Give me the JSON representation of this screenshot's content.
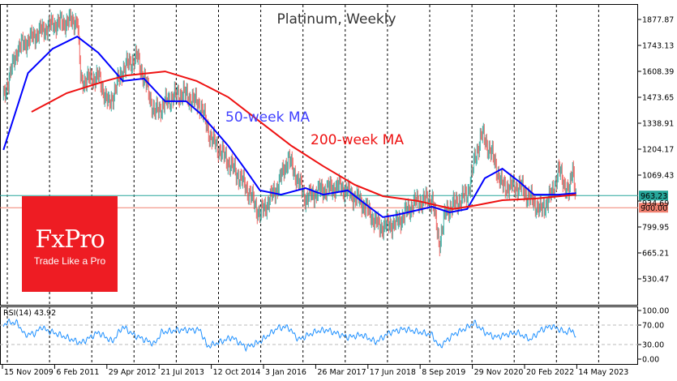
{
  "chart_data": [
    {
      "type": "candlestick",
      "title": "Platinum, Weekly",
      "yticks": [
        "1877.87",
        "1743.13",
        "1608.39",
        "1473.65",
        "1338.91",
        "1204.17",
        "1069.43",
        "934.69",
        "799.95",
        "665.21",
        "530.47"
      ],
      "xticks": [
        "15 Nov 2009",
        "6 Feb 2011",
        "29 Apr 2012",
        "21 Jul 2013",
        "12 Oct 2014",
        "3 Jan 2016",
        "26 Mar 2017",
        "17 Jun 2018",
        "8 Sep 2019",
        "29 Nov 2020",
        "20 Feb 2022",
        "14 May 2023"
      ],
      "ylim": [
        440,
        1920
      ],
      "price": [
        [
          "2009-11",
          1474
        ],
        [
          "2010-03",
          1726
        ],
        [
          "2010-09",
          1810
        ],
        [
          "2011-01",
          1852
        ],
        [
          "2011-08",
          1874
        ],
        [
          "2011-09",
          1558
        ],
        [
          "2012-02",
          1580
        ],
        [
          "2012-05",
          1430
        ],
        [
          "2012-09",
          1621
        ],
        [
          "2013-01",
          1684
        ],
        [
          "2013-04",
          1516
        ],
        [
          "2013-06",
          1390
        ],
        [
          "2013-11",
          1474
        ],
        [
          "2014-02",
          1495
        ],
        [
          "2014-07",
          1432
        ],
        [
          "2014-10",
          1263
        ],
        [
          "2015-03",
          1137
        ],
        [
          "2015-08",
          1010
        ],
        [
          "2015-12",
          863
        ],
        [
          "2016-05",
          1010
        ],
        [
          "2016-08",
          1158
        ],
        [
          "2017-01",
          948
        ],
        [
          "2017-05",
          990
        ],
        [
          "2017-11",
          1010
        ],
        [
          "2018-05",
          926
        ],
        [
          "2018-10",
          800
        ],
        [
          "2019-03",
          821
        ],
        [
          "2019-08",
          926
        ],
        [
          "2020-01",
          948
        ],
        [
          "2020-03",
          716
        ],
        [
          "2020-05",
          884
        ],
        [
          "2020-11",
          968
        ],
        [
          "2021-01",
          1137
        ],
        [
          "2021-03",
          1284
        ],
        [
          "2021-06",
          1179
        ],
        [
          "2021-09",
          1010
        ],
        [
          "2022-02",
          1010
        ],
        [
          "2022-08",
          884
        ],
        [
          "2022-11",
          968
        ],
        [
          "2023-01",
          1095
        ],
        [
          "2023-04",
          968
        ],
        [
          "2023-05",
          1116
        ],
        [
          "2023-06",
          963
        ]
      ],
      "series": [
        {
          "name": "50-week MA",
          "color": "#0000ff",
          "values": [
            [
              "2009-11",
              1200
            ],
            [
              "2010-06",
              1600
            ],
            [
              "2011-01",
              1726
            ],
            [
              "2011-08",
              1789
            ],
            [
              "2012-02",
              1705
            ],
            [
              "2012-09",
              1558
            ],
            [
              "2013-03",
              1571
            ],
            [
              "2013-09",
              1453
            ],
            [
              "2014-03",
              1453
            ],
            [
              "2014-07",
              1390
            ],
            [
              "2015-03",
              1221
            ],
            [
              "2015-08",
              1095
            ],
            [
              "2015-12",
              990
            ],
            [
              "2016-06",
              968
            ],
            [
              "2017-01",
              1002
            ],
            [
              "2017-06",
              968
            ],
            [
              "2018-01",
              990
            ],
            [
              "2018-07",
              905
            ],
            [
              "2018-11",
              851
            ],
            [
              "2019-03",
              863
            ],
            [
              "2020-01",
              905
            ],
            [
              "2020-06",
              876
            ],
            [
              "2020-11",
              893
            ],
            [
              "2021-04",
              1053
            ],
            [
              "2021-09",
              1103
            ],
            [
              "2022-02",
              1032
            ],
            [
              "2022-06",
              968
            ],
            [
              "2023-01",
              968
            ],
            [
              "2023-06",
              976
            ]
          ]
        },
        {
          "name": "200-week MA",
          "color": "#ee1111",
          "values": [
            [
              "2010-07",
              1398
            ],
            [
              "2011-05",
              1495
            ],
            [
              "2012-04",
              1558
            ],
            [
              "2012-10",
              1587
            ],
            [
              "2013-09",
              1608
            ],
            [
              "2014-06",
              1558
            ],
            [
              "2015-03",
              1474
            ],
            [
              "2015-12",
              1347
            ],
            [
              "2016-09",
              1221
            ],
            [
              "2017-06",
              1116
            ],
            [
              "2018-03",
              1019
            ],
            [
              "2018-11",
              960
            ],
            [
              "2019-09",
              935
            ],
            [
              "2020-07",
              893
            ],
            [
              "2021-02",
              914
            ],
            [
              "2021-09",
              939
            ],
            [
              "2022-06",
              947
            ],
            [
              "2023-06",
              968
            ]
          ]
        }
      ],
      "hlines": [
        {
          "label": "963.23",
          "value": 963.23,
          "color": "#26a69a"
        },
        {
          "label": "900.00",
          "value": 900,
          "color": "#f08070"
        }
      ],
      "grid": true
    },
    {
      "type": "line",
      "label": "RSI(14) 43.92",
      "ylim": [
        0,
        100
      ],
      "yticks": [
        "100.00",
        "70.00",
        "30.00",
        "0.00"
      ],
      "levels": [
        70,
        30
      ],
      "color": "#1e90ff",
      "values": [
        [
          "2009-11",
          69
        ],
        [
          "2009-12",
          76
        ],
        [
          "2010-03",
          74
        ],
        [
          "2010-05",
          50
        ],
        [
          "2010-08",
          53
        ],
        [
          "2010-10",
          67
        ],
        [
          "2010-11",
          60
        ],
        [
          "2011-03",
          50
        ],
        [
          "2011-09",
          33
        ],
        [
          "2012-02",
          55
        ],
        [
          "2012-06",
          36
        ],
        [
          "2012-09",
          67
        ],
        [
          "2012-12",
          50
        ],
        [
          "2013-06",
          31
        ],
        [
          "2013-08",
          55
        ],
        [
          "2014-01",
          60
        ],
        [
          "2014-07",
          60
        ],
        [
          "2014-09",
          26
        ],
        [
          "2015-01",
          36
        ],
        [
          "2015-04",
          45
        ],
        [
          "2015-08",
          24
        ],
        [
          "2015-12",
          36
        ],
        [
          "2016-05",
          64
        ],
        [
          "2016-08",
          66
        ],
        [
          "2016-11",
          40
        ],
        [
          "2017-04",
          57
        ],
        [
          "2017-07",
          60
        ],
        [
          "2018-01",
          45
        ],
        [
          "2018-05",
          50
        ],
        [
          "2018-09",
          35
        ],
        [
          "2019-01",
          55
        ],
        [
          "2019-05",
          62
        ],
        [
          "2020-01",
          50
        ],
        [
          "2020-03",
          25
        ],
        [
          "2020-07",
          50
        ],
        [
          "2020-11",
          65
        ],
        [
          "2021-01",
          75
        ],
        [
          "2021-04",
          55
        ],
        [
          "2021-07",
          45
        ],
        [
          "2022-01",
          55
        ],
        [
          "2022-05",
          40
        ],
        [
          "2022-08",
          60
        ],
        [
          "2022-11",
          68
        ],
        [
          "2023-03",
          55
        ],
        [
          "2023-05",
          60
        ],
        [
          "2023-06",
          44
        ]
      ]
    }
  ],
  "logo": {
    "brand": "FxPro",
    "tagline": "Trade Like a Pro"
  }
}
